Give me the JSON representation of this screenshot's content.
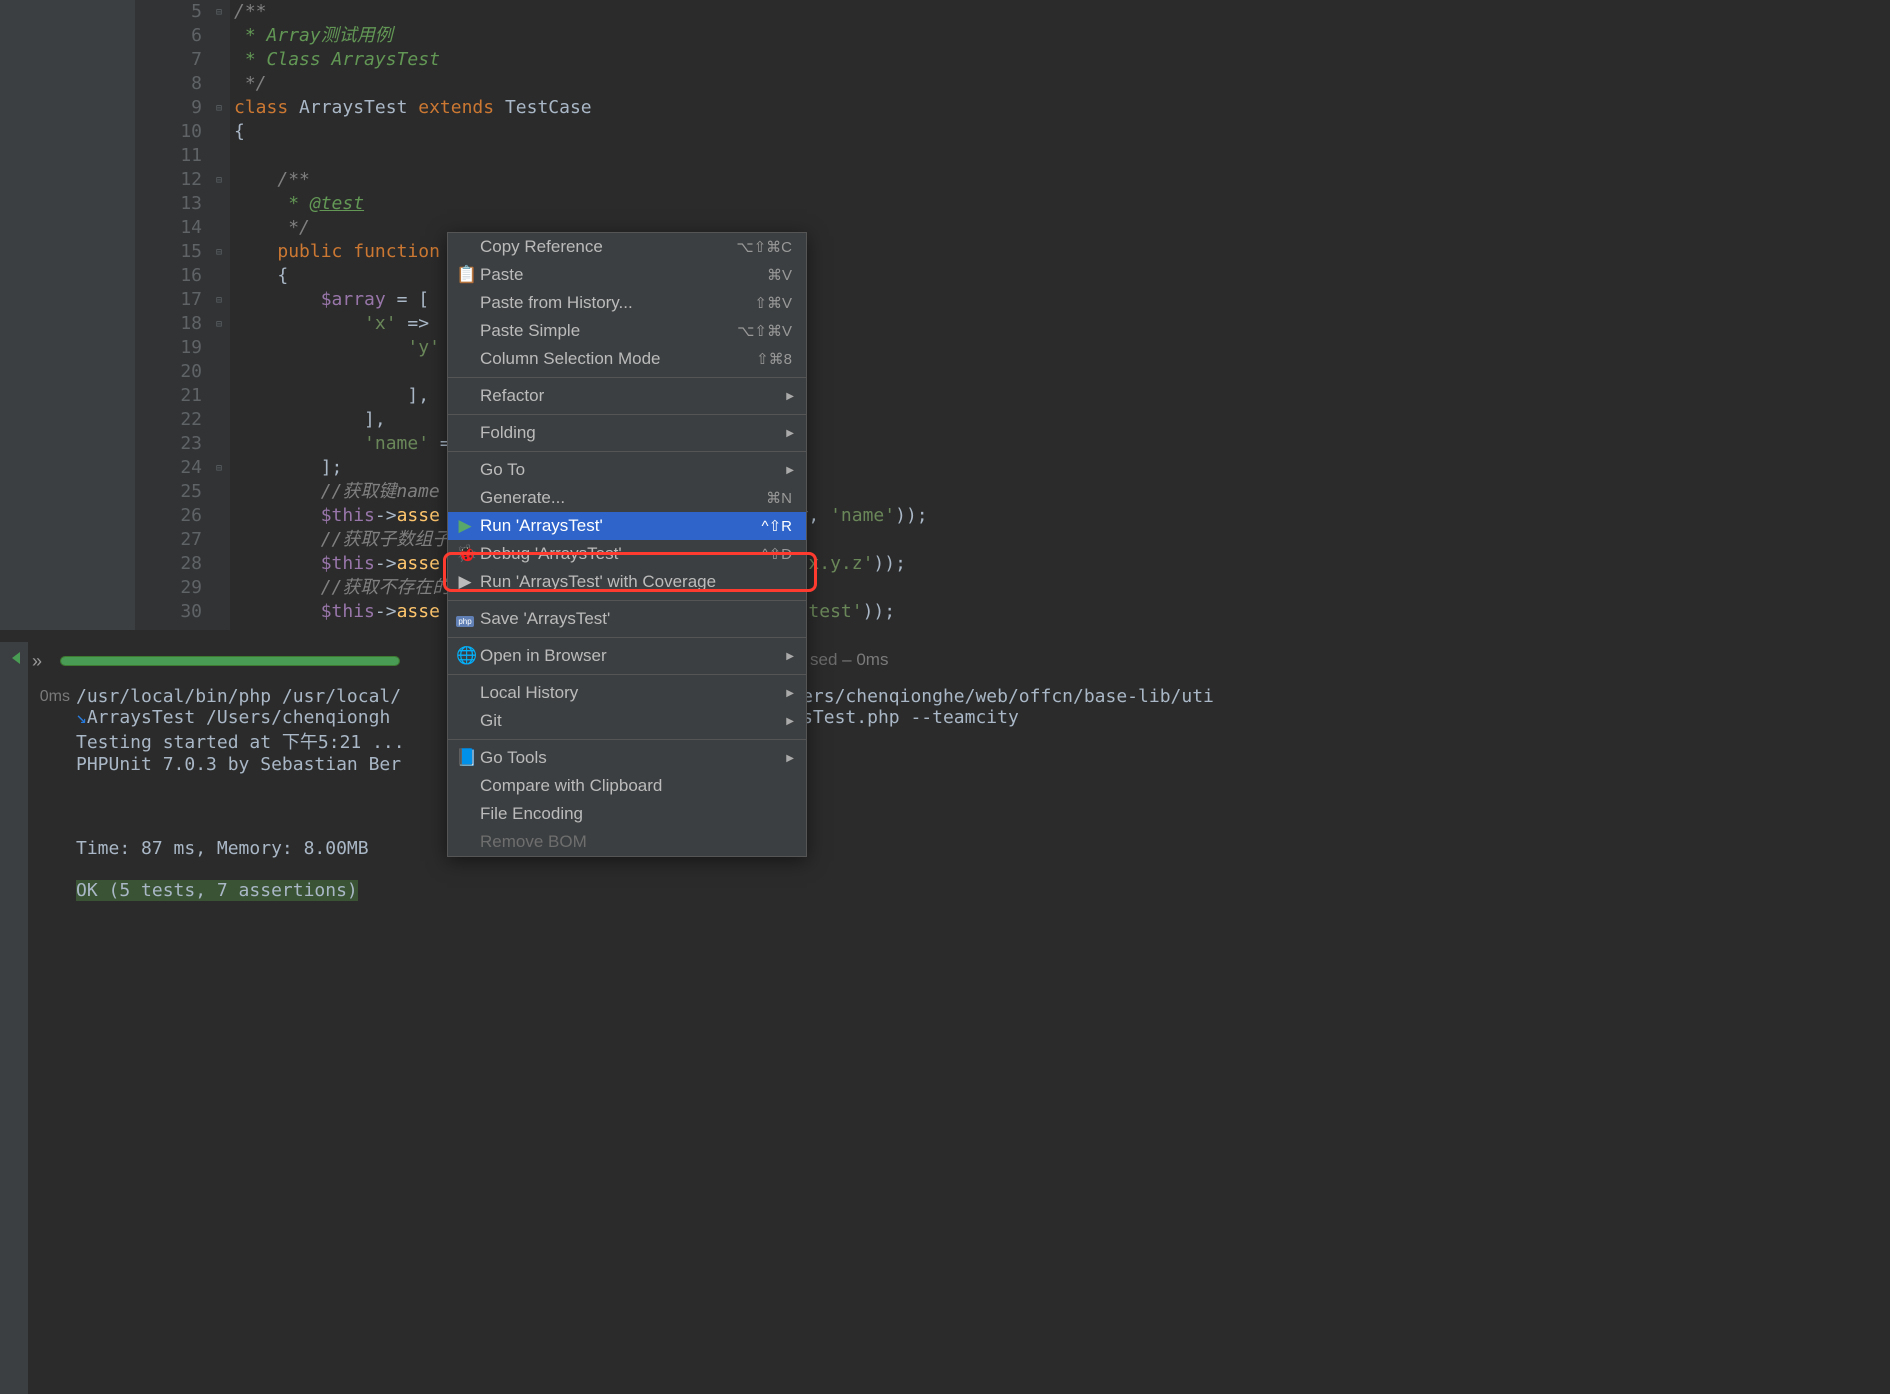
{
  "gutter": {
    "start": 5,
    "end": 30
  },
  "code": {
    "5": {
      "indent": "",
      "html": "<span class='cm'>/**</span>"
    },
    "6": {
      "indent": " ",
      "html": "<span class='gr'>* Array测试用例</span>"
    },
    "7": {
      "indent": " ",
      "html": "<span class='gr'>* Class ArraysTest</span>"
    },
    "8": {
      "indent": " ",
      "html": "<span class='cm'>*/</span>"
    },
    "9": {
      "indent": "",
      "html": "<span class='kw'>class</span> <span class='cls'>ArraysTest</span> <span class='kw'>extends</span> <span class='cls'>TestCase</span>"
    },
    "10": {
      "indent": "",
      "html": "{"
    },
    "11": {
      "indent": "",
      "html": ""
    },
    "12": {
      "indent": "    ",
      "html": "<span class='cm'>/**</span>"
    },
    "13": {
      "indent": "     ",
      "html": "<span class='gr'>* </span><span class='ann'>@test</span>"
    },
    "14": {
      "indent": "     ",
      "html": "<span class='cm'>*/</span>"
    },
    "15": {
      "indent": "    ",
      "html": "<span class='kw'>public</span> <span class='kw'>function</span> "
    },
    "16": {
      "indent": "    ",
      "html": "{"
    },
    "17": {
      "indent": "        ",
      "html": "<span class='va'>$array</span> = ["
    },
    "18": {
      "indent": "            ",
      "html": "<span class='str'>'x'</span> =&gt; "
    },
    "19": {
      "indent": "                ",
      "html": "<span class='str'>'y'</span>"
    },
    "20": {
      "indent": "",
      "html": ""
    },
    "21": {
      "indent": "                ",
      "html": "],"
    },
    "22": {
      "indent": "            ",
      "html": "],"
    },
    "23": {
      "indent": "            ",
      "html": "<span class='str'>'name'</span> ="
    },
    "24": {
      "indent": "        ",
      "html": "];"
    },
    "25": {
      "indent": "        ",
      "html": "<span class='cm'>//获取键name</span>"
    },
    "26": {
      "indent": "        ",
      "html": "<span class='va'>$this</span>-&gt;<span class='fn'>asse</span>                               ray, <span class='str'>'name'</span>));"
    },
    "27": {
      "indent": "        ",
      "html": "<span class='cm'>//获取子数组子</span>"
    },
    "28": {
      "indent": "        ",
      "html": "<span class='va'>$this</span>-&gt;<span class='fn'>asse</span>                                 <span class='str'>'x.y.z'</span>));"
    },
    "29": {
      "indent": "        ",
      "html": "<span class='cm'>//获取不存在的</span>"
    },
    "30": {
      "indent": "        ",
      "html": "<span class='va'>$this</span>-&gt;<span class='fn'>asse</span>                                 <span class='str'>'test'</span>));"
    }
  },
  "menu": {
    "items": [
      {
        "label": "Copy Reference",
        "shortcut": "⌥⇧⌘C"
      },
      {
        "label": "Paste",
        "shortcut": "⌘V",
        "icon": "📋"
      },
      {
        "label": "Paste from History...",
        "shortcut": "⇧⌘V"
      },
      {
        "label": "Paste Simple",
        "shortcut": "⌥⇧⌘V"
      },
      {
        "label": "Column Selection Mode",
        "shortcut": "⇧⌘8"
      },
      {
        "sep": true
      },
      {
        "label": "Refactor",
        "submenu": true
      },
      {
        "sep": true
      },
      {
        "label": "Folding",
        "submenu": true
      },
      {
        "sep": true
      },
      {
        "label": "Go To",
        "submenu": true
      },
      {
        "label": "Generate...",
        "shortcut": "⌘N"
      },
      {
        "label": "Run 'ArraysTest'",
        "shortcut": "^⇧R",
        "icon": "▶",
        "iconColor": "#59a869",
        "selected": true
      },
      {
        "label": "Debug 'ArraysTest'",
        "shortcut": "^⇧D",
        "icon": "🐞"
      },
      {
        "label": "Run 'ArraysTest' with Coverage",
        "icon": "▶"
      },
      {
        "sep": true
      },
      {
        "label": "Save 'ArraysTest'",
        "icon": "php"
      },
      {
        "sep": true
      },
      {
        "label": "Open in Browser",
        "submenu": true,
        "icon": "🌐"
      },
      {
        "sep": true
      },
      {
        "label": "Local History",
        "submenu": true
      },
      {
        "label": "Git",
        "submenu": true
      },
      {
        "sep": true
      },
      {
        "label": "Go Tools",
        "submenu": true,
        "icon": "📘"
      },
      {
        "label": "Compare with Clipboard"
      },
      {
        "label": "File Encoding"
      },
      {
        "label": "Remove BOM",
        "disabled": true
      }
    ]
  },
  "status": {
    "passed": "sed",
    "time": "0ms"
  },
  "tree": {
    "ms": "0ms"
  },
  "console": {
    "line1_a": "/usr/local/bin/php /usr/local/",
    "line1_b": "Users/chenqionghe/web/offcn/base-lib/uti",
    "line2_a": "ArraysTest /Users/chenqiongh",
    "line2_b": "ts/ArraysTest.php --teamcity",
    "line3": "Testing started at 下午5:21 ...",
    "line4": "PHPUnit 7.0.3 by Sebastian Ber",
    "time": "Time: 87 ms, Memory: 8.00MB",
    "ok": "OK (5 tests, 7 assertions)"
  },
  "toolbar": {
    "expand": "»"
  }
}
